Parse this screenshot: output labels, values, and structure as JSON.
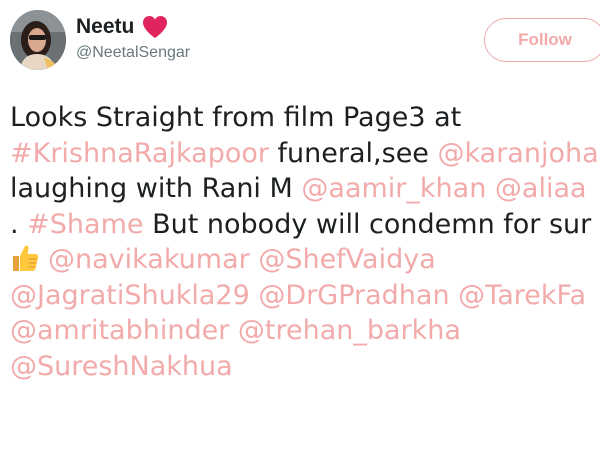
{
  "user": {
    "display_name": "Neetu",
    "handle": "@NeetalSengar",
    "verified_icon": "heart-icon",
    "avatar_icon": "avatar"
  },
  "follow_button": {
    "label": "Follow"
  },
  "colors": {
    "link": "#f2aaaa",
    "text": "#1c2022",
    "handle": "#69787f",
    "heart": "#e0245e"
  },
  "tweet": {
    "line1": {
      "t1": "Looks Straight from film Page3 at"
    },
    "line2": {
      "hashtag_krishna": "#KrishnaRajkapoor",
      "t2": " funeral,see ",
      "mention_karan": "@karanjoha"
    },
    "line3": {
      "t3": "laughing with Rani M ",
      "mention_aamir": "@aamir_khan",
      "t3b": " ",
      "mention_aliaa": "@aliaa"
    },
    "line4": {
      "t4": ". ",
      "hashtag_shame": "#Shame",
      "t5": " But nobody will condemn for sur"
    },
    "line5": {
      "thumb_icon": "thumbs-up-icon",
      "mention_navika": "@navikakumar",
      "t6": " ",
      "mention_shef": "@ShefVaidya"
    },
    "line6": {
      "mention_jagrati": "@JagratiShukla29",
      "t7": " ",
      "mention_drg": "@DrGPradhan",
      "t8": " ",
      "mention_tarek": "@TarekFa"
    },
    "line7": {
      "mention_amrita": "@amritabhinder",
      "t9": " ",
      "mention_trehan": "@trehan_barkha"
    },
    "line8": {
      "mention_suresh": "@SureshNakhua"
    }
  }
}
